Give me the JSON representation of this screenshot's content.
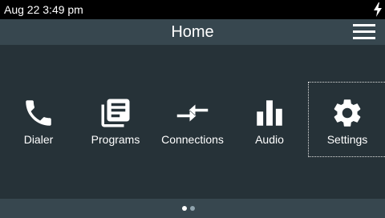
{
  "status_bar": {
    "datetime": "Aug 22 3:49 pm",
    "charging_icon": "lightning-bolt"
  },
  "header": {
    "title": "Home",
    "menu_icon": "hamburger-menu"
  },
  "apps": [
    {
      "label": "Dialer",
      "icon": "phone",
      "selected": false
    },
    {
      "label": "Programs",
      "icon": "document-list",
      "selected": false
    },
    {
      "label": "Connections",
      "icon": "swap-arrows",
      "selected": false
    },
    {
      "label": "Audio",
      "icon": "bar-chart",
      "selected": false
    },
    {
      "label": "Settings",
      "icon": "gear",
      "selected": true
    }
  ],
  "pager": {
    "pages": 2,
    "current": 1,
    "active_color": "#ffffff",
    "inactive_color": "#90a4ae"
  },
  "colors": {
    "status_bar": "#000000",
    "header": "#37474f",
    "background": "#263238",
    "footer": "#37474f"
  }
}
